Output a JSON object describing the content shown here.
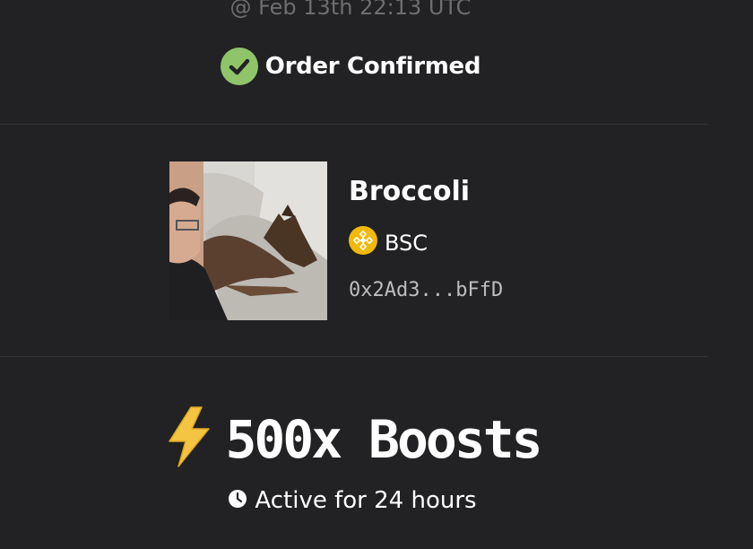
{
  "order": {
    "timestamp": "@ Feb 13th 22:13 UTC",
    "status": "Order Confirmed"
  },
  "token": {
    "name": "Broccoli",
    "chain": "BSC",
    "address": "0x2Ad3...bFfD",
    "image_alt": "Broccoli token image"
  },
  "boost": {
    "label": "500x Boosts",
    "duration": "Active for 24 hours"
  },
  "colors": {
    "background": "#222124",
    "success_green": "#8fc46a",
    "bsc_yellow": "#f0b90b",
    "bolt_yellow": "#f4c542"
  },
  "icons": {
    "status": "check-circle-icon",
    "chain": "bsc-icon",
    "boost": "lightning-icon",
    "duration": "clock-icon"
  }
}
